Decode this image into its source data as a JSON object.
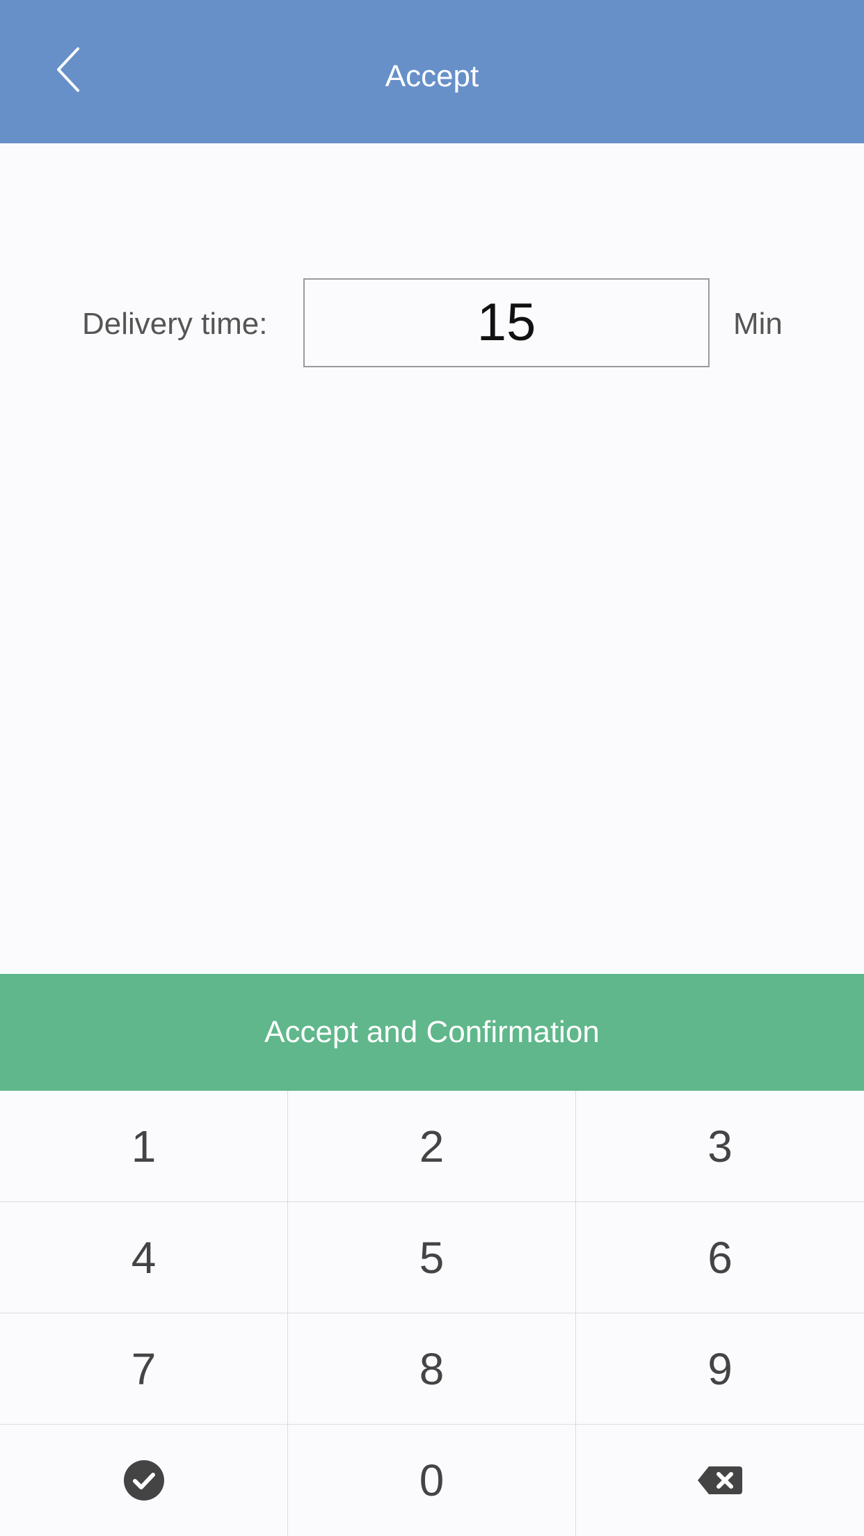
{
  "header": {
    "title": "Accept",
    "back_icon": "chevron-left-icon",
    "background_color": "#6790c9"
  },
  "form": {
    "delivery_label": "Delivery time:",
    "delivery_value": "15",
    "unit": "Min"
  },
  "confirm_button": {
    "label": "Accept and Confirmation",
    "background_color": "#60b78b"
  },
  "keypad": {
    "keys": [
      "1",
      "2",
      "3",
      "4",
      "5",
      "6",
      "7",
      "8",
      "9",
      "0"
    ],
    "confirm_icon": "check-circle-icon",
    "delete_icon": "backspace-icon"
  }
}
